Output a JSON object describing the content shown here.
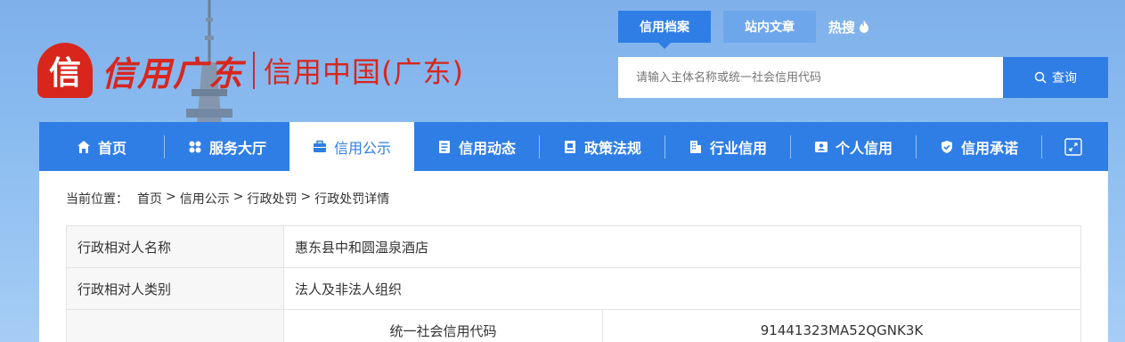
{
  "brand": {
    "logo_letter": "信",
    "logo_script": "信用广东",
    "logo_text": "信用中国(广东)",
    "accent_color": "#d8261d",
    "primary_color": "#2f7ee6"
  },
  "search": {
    "tabs": [
      {
        "label": "信用档案",
        "active": true
      },
      {
        "label": "站内文章",
        "active": false
      }
    ],
    "hot_label": "热搜",
    "placeholder": "请输入主体名称或统一社会信用代码",
    "button_label": "查询"
  },
  "nav": {
    "items": [
      {
        "label": "首页",
        "icon": "home-icon"
      },
      {
        "label": "服务大厅",
        "icon": "grid-icon"
      },
      {
        "label": "信用公示",
        "icon": "briefcase-icon",
        "active": true
      },
      {
        "label": "信用动态",
        "icon": "document-icon"
      },
      {
        "label": "政策法规",
        "icon": "book-icon"
      },
      {
        "label": "行业信用",
        "icon": "building-icon"
      },
      {
        "label": "个人信用",
        "icon": "person-card-icon"
      },
      {
        "label": "信用承诺",
        "icon": "shield-check-icon"
      }
    ],
    "expand_icon": "fullscreen-icon"
  },
  "breadcrumb": {
    "prefix": "当前位置：",
    "items": [
      "首页",
      "信用公示",
      "行政处罚",
      "行政处罚详情"
    ],
    "separator": ">"
  },
  "details": {
    "rows": [
      {
        "label": "行政相对人名称",
        "value": "惠东县中和圆温泉酒店"
      },
      {
        "label": "行政相对人类别",
        "value": "法人及非法人组织"
      }
    ],
    "code_row": {
      "label": "统一社会信用代码",
      "value": "91441323MA52QGNK3K"
    }
  }
}
